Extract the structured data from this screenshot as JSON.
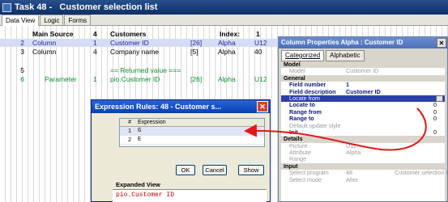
{
  "window": {
    "title": "Task 48 -   Customer selection list"
  },
  "tabs": [
    "Data View",
    "Logic",
    "Forms"
  ],
  "grid": {
    "header": {
      "main": "Main Source",
      "val": "4",
      "name": "Customers",
      "index": "Index:",
      "index_val": "1"
    },
    "rows": [
      {
        "num": "2",
        "type": "Column",
        "val": "1",
        "name": "Customer ID",
        "size": "[26]",
        "attr": "Alpha",
        "pic": "U12"
      },
      {
        "num": "3",
        "type": "Column",
        "val": "4",
        "name": "Company name",
        "size": "[5]",
        "attr": "Alpha",
        "pic": "40"
      },
      {
        "num": "5",
        "text": "== Returned value ==="
      },
      {
        "num": "6",
        "type": "Parameter",
        "val": "1",
        "name": "pio.Customer ID",
        "size": "[26]",
        "attr": "Alpha",
        "pic": "U12"
      }
    ]
  },
  "props": {
    "title": "Column Properties Alpha : Customer ID",
    "tabs": [
      "Categorized",
      "Alphabetic"
    ],
    "rows": [
      {
        "kind": "section",
        "k": "Model"
      },
      {
        "kind": "dim",
        "k": "Model",
        "v": "Customer ID"
      },
      {
        "kind": "section",
        "k": "General"
      },
      {
        "kind": "bold",
        "k": "Field number",
        "v": "1"
      },
      {
        "kind": "bold",
        "k": "Field description",
        "v": "Customer ID"
      },
      {
        "kind": "hl",
        "k": "Locate from"
      },
      {
        "kind": "bold",
        "k": "Locate to",
        "n": "0"
      },
      {
        "kind": "bold",
        "k": "Range from",
        "n": "0"
      },
      {
        "kind": "bold",
        "k": "Range to",
        "n": "0"
      },
      {
        "kind": "dim",
        "k": "Default update style"
      },
      {
        "kind": "bold",
        "k": "Init",
        "n": "0"
      },
      {
        "kind": "section",
        "k": "Details"
      },
      {
        "kind": "dim",
        "k": "Picture",
        "v": "U12"
      },
      {
        "kind": "dim",
        "k": "Attribute",
        "v": "Alpha"
      },
      {
        "kind": "dim",
        "k": "Range"
      },
      {
        "kind": "section",
        "k": "Input"
      },
      {
        "kind": "dim",
        "k": "Select program",
        "v": "48",
        "v2": "Customer selection li"
      },
      {
        "kind": "dim",
        "k": "Select mode",
        "v": "After"
      }
    ]
  },
  "expr": {
    "title": "Expression Rules: 48 -   Customer s...",
    "col_num": "#",
    "col_expr": "Expression",
    "rows": [
      {
        "n": "1",
        "e": "G"
      },
      {
        "n": "2",
        "e": "E"
      }
    ],
    "ok": "OK",
    "cancel": "Cancel",
    "show": "Show",
    "expanded_label": "Expanded View",
    "expanded_value": "pio.Customer ID"
  }
}
